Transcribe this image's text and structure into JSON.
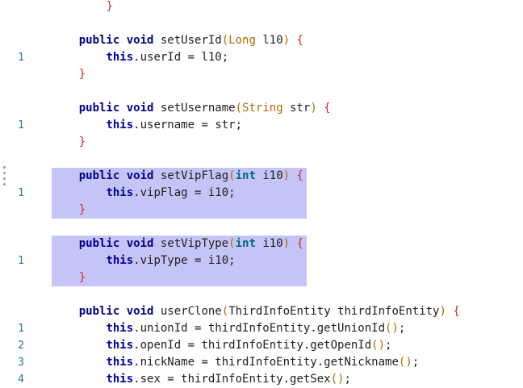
{
  "editor": {
    "lines": [
      {
        "gutter": "",
        "tokens": [
          {
            "t": "        ",
            "c": "p"
          },
          {
            "t": "}",
            "c": "brace"
          }
        ]
      },
      {
        "gutter": "",
        "tokens": []
      },
      {
        "gutter": "",
        "tokens": [
          {
            "t": "    ",
            "c": "p"
          },
          {
            "t": "public",
            "c": "kw"
          },
          {
            "t": " ",
            "c": "p"
          },
          {
            "t": "void",
            "c": "kw"
          },
          {
            "t": " setUserId",
            "c": "p"
          },
          {
            "t": "(",
            "c": "paren"
          },
          {
            "t": "Long",
            "c": "type"
          },
          {
            "t": " l10",
            "c": "p"
          },
          {
            "t": ")",
            "c": "paren"
          },
          {
            "t": " ",
            "c": "p"
          },
          {
            "t": "{",
            "c": "brace"
          }
        ]
      },
      {
        "gutter": "1",
        "tokens": [
          {
            "t": "        ",
            "c": "p"
          },
          {
            "t": "this",
            "c": "kw2"
          },
          {
            "t": ".userId = l10;",
            "c": "p"
          }
        ]
      },
      {
        "gutter": "",
        "tokens": [
          {
            "t": "    ",
            "c": "p"
          },
          {
            "t": "}",
            "c": "brace"
          }
        ]
      },
      {
        "gutter": "",
        "tokens": []
      },
      {
        "gutter": "",
        "tokens": [
          {
            "t": "    ",
            "c": "p"
          },
          {
            "t": "public",
            "c": "kw"
          },
          {
            "t": " ",
            "c": "p"
          },
          {
            "t": "void",
            "c": "kw"
          },
          {
            "t": " setUsername",
            "c": "p"
          },
          {
            "t": "(",
            "c": "paren"
          },
          {
            "t": "String",
            "c": "type"
          },
          {
            "t": " str",
            "c": "p"
          },
          {
            "t": ")",
            "c": "paren"
          },
          {
            "t": " ",
            "c": "p"
          },
          {
            "t": "{",
            "c": "brace"
          }
        ]
      },
      {
        "gutter": "1",
        "tokens": [
          {
            "t": "        ",
            "c": "p"
          },
          {
            "t": "this",
            "c": "kw2"
          },
          {
            "t": ".username = str;",
            "c": "p"
          }
        ]
      },
      {
        "gutter": "",
        "tokens": [
          {
            "t": "    ",
            "c": "p"
          },
          {
            "t": "}",
            "c": "brace"
          }
        ]
      },
      {
        "gutter": "",
        "tokens": []
      },
      {
        "gutter": "",
        "tokens": [
          {
            "t": "    ",
            "c": "p"
          },
          {
            "t": "public",
            "c": "kw"
          },
          {
            "t": " ",
            "c": "p"
          },
          {
            "t": "void",
            "c": "kw"
          },
          {
            "t": " setVipFlag",
            "c": "p"
          },
          {
            "t": "(",
            "c": "paren"
          },
          {
            "t": "int",
            "c": "prim"
          },
          {
            "t": " i10",
            "c": "p"
          },
          {
            "t": ")",
            "c": "paren"
          },
          {
            "t": " ",
            "c": "p"
          },
          {
            "t": "{",
            "c": "brace"
          }
        ]
      },
      {
        "gutter": "1",
        "tokens": [
          {
            "t": "        ",
            "c": "p"
          },
          {
            "t": "this",
            "c": "kw2"
          },
          {
            "t": ".vipFlag = i10;",
            "c": "p"
          }
        ]
      },
      {
        "gutter": "",
        "tokens": [
          {
            "t": "    ",
            "c": "p"
          },
          {
            "t": "}",
            "c": "brace"
          }
        ]
      },
      {
        "gutter": "",
        "tokens": []
      },
      {
        "gutter": "",
        "tokens": [
          {
            "t": "    ",
            "c": "p"
          },
          {
            "t": "public",
            "c": "kw"
          },
          {
            "t": " ",
            "c": "p"
          },
          {
            "t": "void",
            "c": "kw"
          },
          {
            "t": " setVipType",
            "c": "p"
          },
          {
            "t": "(",
            "c": "paren"
          },
          {
            "t": "int",
            "c": "prim"
          },
          {
            "t": " i10",
            "c": "p"
          },
          {
            "t": ")",
            "c": "paren"
          },
          {
            "t": " ",
            "c": "p"
          },
          {
            "t": "{",
            "c": "brace"
          }
        ]
      },
      {
        "gutter": "1",
        "tokens": [
          {
            "t": "        ",
            "c": "p"
          },
          {
            "t": "this",
            "c": "kw2"
          },
          {
            "t": ".vipType = i10;",
            "c": "p"
          }
        ]
      },
      {
        "gutter": "",
        "tokens": [
          {
            "t": "    ",
            "c": "p"
          },
          {
            "t": "}",
            "c": "brace"
          }
        ]
      },
      {
        "gutter": "",
        "tokens": []
      },
      {
        "gutter": "",
        "tokens": [
          {
            "t": "    ",
            "c": "p"
          },
          {
            "t": "public",
            "c": "kw"
          },
          {
            "t": " ",
            "c": "p"
          },
          {
            "t": "void",
            "c": "kw"
          },
          {
            "t": " userClone",
            "c": "p"
          },
          {
            "t": "(",
            "c": "paren"
          },
          {
            "t": "ThirdInfoEntity thirdInfoEntity",
            "c": "p"
          },
          {
            "t": ")",
            "c": "paren"
          },
          {
            "t": " ",
            "c": "p"
          },
          {
            "t": "{",
            "c": "brace"
          }
        ]
      },
      {
        "gutter": "1",
        "tokens": [
          {
            "t": "        ",
            "c": "p"
          },
          {
            "t": "this",
            "c": "kw2"
          },
          {
            "t": ".unionId = thirdInfoEntity.getUnionId",
            "c": "p"
          },
          {
            "t": "()",
            "c": "paren"
          },
          {
            "t": ";",
            "c": "p"
          }
        ]
      },
      {
        "gutter": "2",
        "tokens": [
          {
            "t": "        ",
            "c": "p"
          },
          {
            "t": "this",
            "c": "kw2"
          },
          {
            "t": ".openId = thirdInfoEntity.getOpenId",
            "c": "p"
          },
          {
            "t": "()",
            "c": "paren"
          },
          {
            "t": ";",
            "c": "p"
          }
        ]
      },
      {
        "gutter": "3",
        "tokens": [
          {
            "t": "        ",
            "c": "p"
          },
          {
            "t": "this",
            "c": "kw2"
          },
          {
            "t": ".nickName = thirdInfoEntity.getNickname",
            "c": "p"
          },
          {
            "t": "()",
            "c": "paren"
          },
          {
            "t": ";",
            "c": "p"
          }
        ]
      },
      {
        "gutter": "4",
        "tokens": [
          {
            "t": "        ",
            "c": "p"
          },
          {
            "t": "this",
            "c": "kw2"
          },
          {
            "t": ".sex = thirdInfoEntity.getSex",
            "c": "p"
          },
          {
            "t": "()",
            "c": "paren"
          },
          {
            "t": ";",
            "c": "p"
          }
        ]
      }
    ],
    "highlighted_ranges": [
      [
        10,
        12
      ],
      [
        14,
        16
      ]
    ],
    "colors": {
      "highlight": "#c4c4f6",
      "keyword": "#00008b",
      "primitive": "#006b75",
      "type": "#b06a00",
      "brace": "#d6262a",
      "gutter": "#237893"
    }
  }
}
